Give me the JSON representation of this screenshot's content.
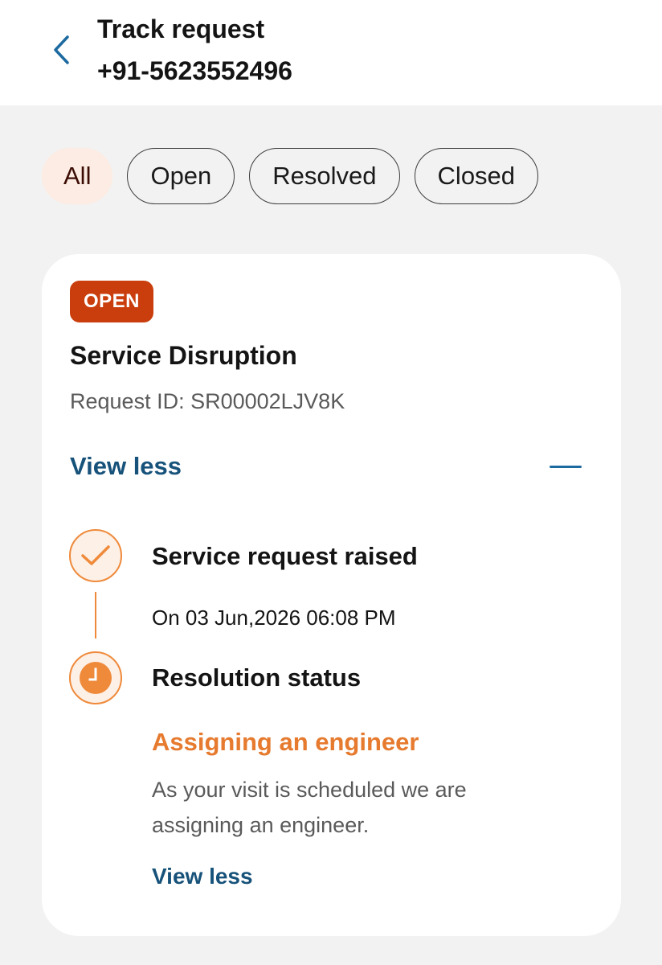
{
  "header": {
    "title": "Track request",
    "subtitle": "+91-5623552496"
  },
  "filters": [
    {
      "label": "All",
      "active": true
    },
    {
      "label": "Open",
      "active": false
    },
    {
      "label": "Resolved",
      "active": false
    },
    {
      "label": "Closed",
      "active": false
    }
  ],
  "request": {
    "status": "OPEN",
    "title": "Service Disruption",
    "request_id": "Request ID: SR00002LJV8K",
    "view_less_label": "View less",
    "timeline": [
      {
        "title": "Service request raised",
        "date": "On 03 Jun,2026 06:08 PM",
        "icon": "check-icon"
      },
      {
        "title": "Resolution status",
        "icon": "clock-icon"
      }
    ],
    "resolution": {
      "headline": "Assigning an engineer",
      "description": "As your visit is scheduled we are assigning an engineer.",
      "view_less_label": "View less"
    }
  },
  "colors": {
    "accent_orange": "#ef8a3b",
    "badge_red": "#c93e0c",
    "link_blue": "#17527a",
    "chip_active_bg": "#fcece3"
  }
}
